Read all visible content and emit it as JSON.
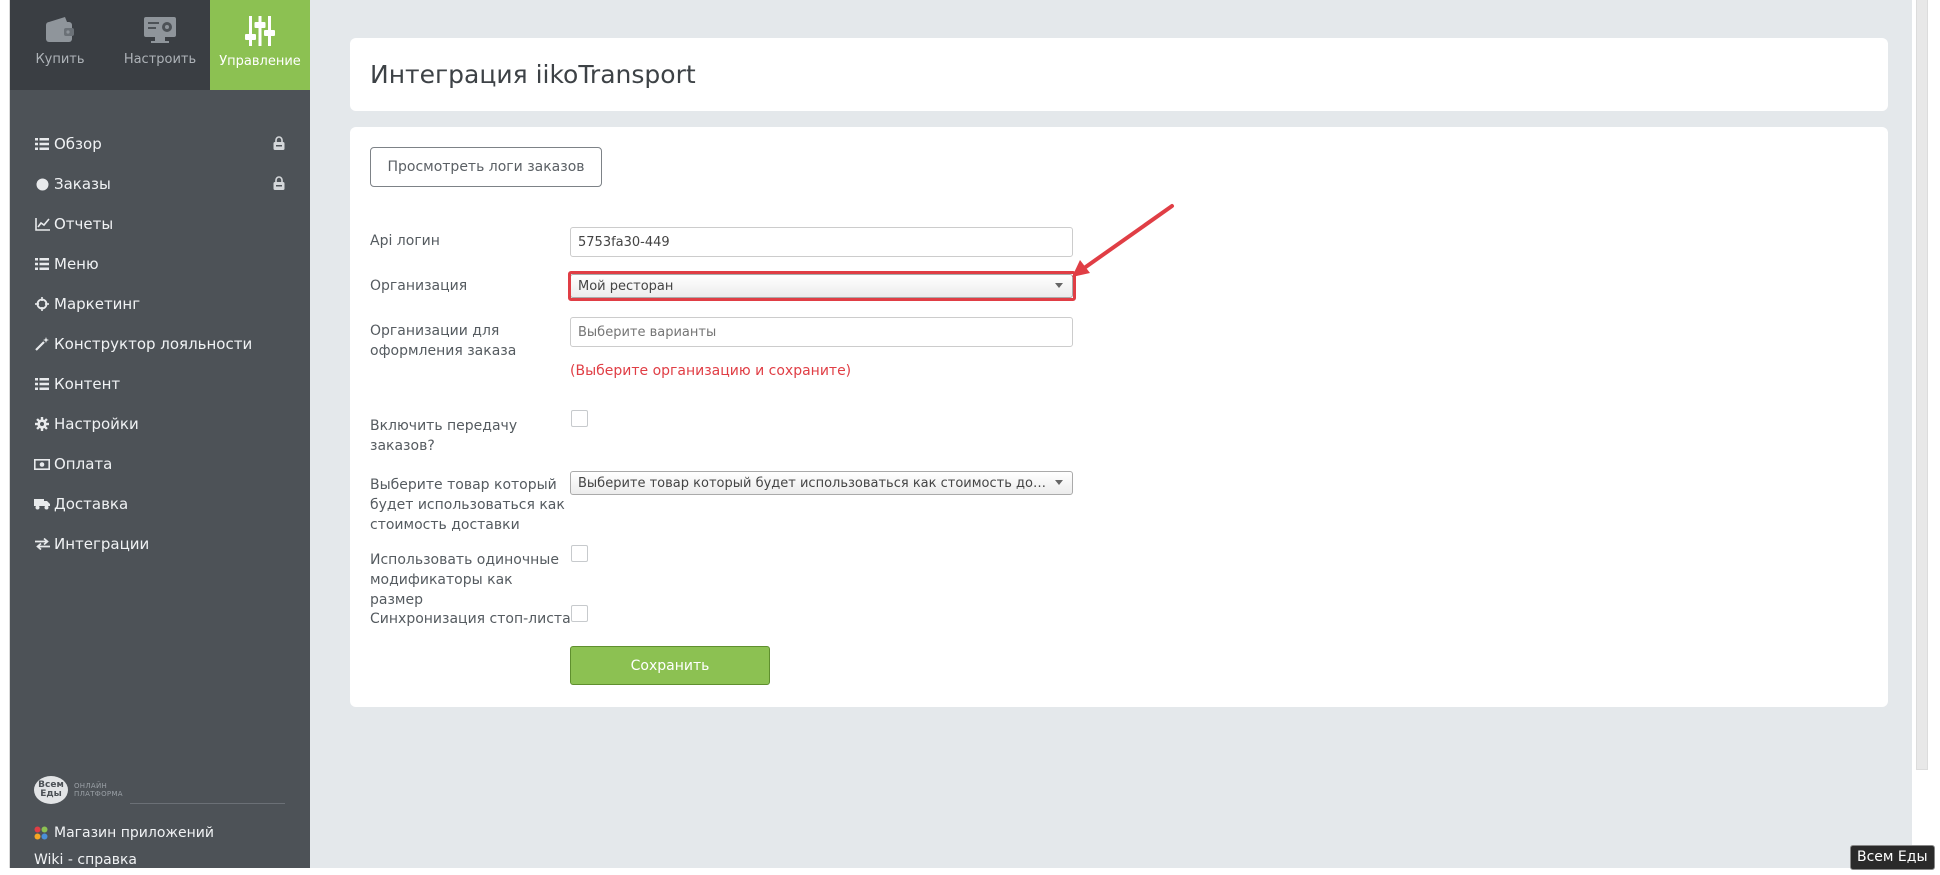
{
  "topnav": [
    {
      "label": "Купить",
      "icon": "wallet-icon"
    },
    {
      "label": "Настроить",
      "icon": "monitor-settings-icon"
    },
    {
      "label": "Управление",
      "icon": "sliders-icon",
      "active": true
    }
  ],
  "menu": [
    {
      "label": "Обзор",
      "icon": "list-icon",
      "locked": true
    },
    {
      "label": "Заказы",
      "icon": "circle-icon",
      "locked": true
    },
    {
      "label": "Отчеты",
      "icon": "chart-line-icon"
    },
    {
      "label": "Меню",
      "icon": "list-icon"
    },
    {
      "label": "Маркетинг",
      "icon": "crosshair-icon"
    },
    {
      "label": "Конструктор лояльности",
      "icon": "magic-wand-icon"
    },
    {
      "label": "Контент",
      "icon": "list-icon"
    },
    {
      "label": "Настройки",
      "icon": "gear-icon"
    },
    {
      "label": "Оплата",
      "icon": "money-icon"
    },
    {
      "label": "Доставка",
      "icon": "truck-icon"
    },
    {
      "label": "Интеграции",
      "icon": "exchange-icon"
    }
  ],
  "brand": {
    "logo_text": "Всем Еды",
    "tagline": "ОНЛАЙН ПЛАТФОРМА"
  },
  "appstore": {
    "label": "Магазин приложений"
  },
  "wiki": {
    "label": "Wiki - справка"
  },
  "page": {
    "title": "Интеграция iikoTransport"
  },
  "form": {
    "logs_button": "Просмотреть логи заказов",
    "api_login": {
      "label": "Api логин",
      "value": "5753fa30-449"
    },
    "organization": {
      "label": "Организация",
      "value": "Мой ресторан"
    },
    "order_orgs": {
      "label": "Организации для оформления заказа",
      "placeholder": "Выберите варианты",
      "hint": "(Выберите организацию и сохраните)"
    },
    "enable_transfer": {
      "label": "Включить передачу заказов?",
      "checked": false
    },
    "delivery_product": {
      "label": "Выберите товар который будет использоваться как стоимость доставки",
      "value": "Выберите товар который будет использоваться как стоимость доставки"
    },
    "single_modifiers": {
      "label": "Использовать одиночные модификаторы как размер",
      "checked": false
    },
    "stoplist_sync": {
      "label": "Синхронизация стоп-листа",
      "checked": false
    },
    "save_button": "Сохранить"
  },
  "tooltip": {
    "text": "Всем Еды"
  },
  "colors": {
    "accent": "#8cc152",
    "sidebar": "#4d5257",
    "highlight": "#e03e45",
    "background": "#e4e8eb"
  }
}
